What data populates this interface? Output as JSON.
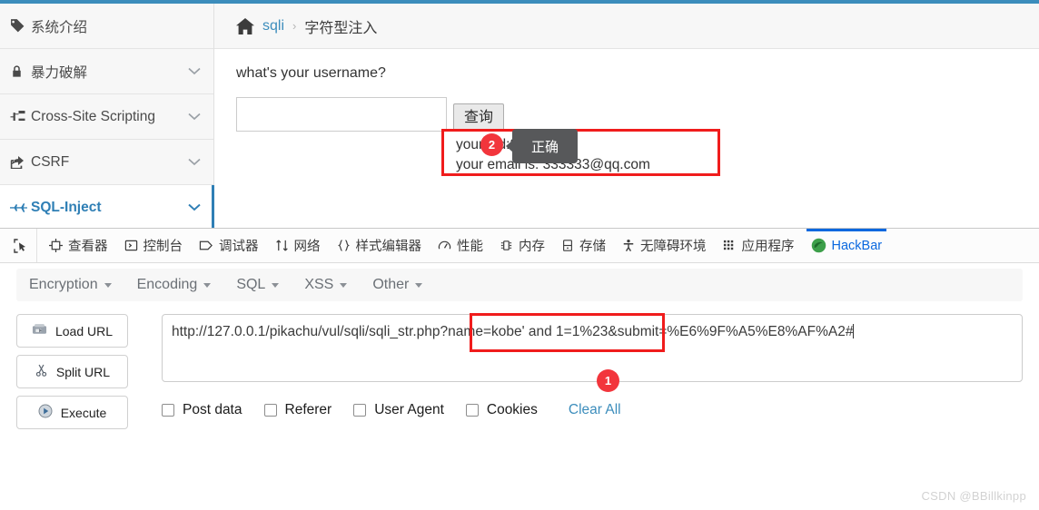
{
  "theme": {
    "accent_blue": "#3c8dbc",
    "tab_active_blue": "#0a68df",
    "highlight_red": "#f01c1c",
    "badge_red": "#f2353c",
    "tooltip_gray": "#57585a"
  },
  "sidebar": {
    "items": [
      {
        "label": "系统介绍",
        "icon": "tag-icon",
        "has_chevron": false,
        "active": false
      },
      {
        "label": "暴力破解",
        "icon": "lock-icon",
        "has_chevron": true,
        "active": false
      },
      {
        "label": "Cross-Site Scripting",
        "icon": "sitemap-icon",
        "has_chevron": true,
        "active": false
      },
      {
        "label": "CSRF",
        "icon": "share-icon",
        "has_chevron": true,
        "active": false
      },
      {
        "label": "SQL-Inject",
        "icon": "plane-icon",
        "has_chevron": true,
        "active": true
      }
    ]
  },
  "breadcrumb": {
    "home_icon": "home-icon",
    "root": "sqli",
    "separator": "›",
    "current": "字符型注入"
  },
  "form": {
    "question": "what's your username?",
    "input_value": "",
    "input_placeholder": "",
    "submit_label": "查询"
  },
  "result": {
    "line1": "your uid:3",
    "line2": "your email is: 333333@qq.com"
  },
  "annotations": {
    "badge_two": "2",
    "badge_one": "1",
    "tooltip": "正确"
  },
  "devtools": {
    "picker_icon": "cursor-picker-icon",
    "tabs": [
      {
        "label": "查看器",
        "icon": "inspector-icon",
        "selected": false
      },
      {
        "label": "控制台",
        "icon": "console-icon",
        "selected": false
      },
      {
        "label": "调试器",
        "icon": "debugger-icon",
        "selected": false
      },
      {
        "label": "网络",
        "icon": "network-icon",
        "selected": false
      },
      {
        "label": "样式编辑器",
        "icon": "style-editor-icon",
        "selected": false
      },
      {
        "label": "性能",
        "icon": "performance-icon",
        "selected": false
      },
      {
        "label": "内存",
        "icon": "memory-icon",
        "selected": false
      },
      {
        "label": "存储",
        "icon": "storage-icon",
        "selected": false
      },
      {
        "label": "无障碍环境",
        "icon": "accessibility-icon",
        "selected": false
      },
      {
        "label": "应用程序",
        "icon": "application-icon",
        "selected": false
      },
      {
        "label": "HackBar",
        "icon": "hackbar-icon",
        "selected": true
      }
    ]
  },
  "hackbar": {
    "menu": [
      {
        "label": "Encryption"
      },
      {
        "label": "Encoding"
      },
      {
        "label": "SQL"
      },
      {
        "label": "XSS"
      },
      {
        "label": "Other"
      }
    ],
    "actions": [
      {
        "label": "Load URL",
        "icon": "load-url-icon"
      },
      {
        "label": "Split URL",
        "icon": "scissors-icon"
      },
      {
        "label": "Execute",
        "icon": "play-icon"
      }
    ],
    "url_base": "http://127.0.0.1/pikachu/vul/sqli/sqli_str.php",
    "url_query": "?name=kobe' and 1=1%23",
    "url_tail": "&submit=%E6%9F%A5%E8%AF%A2#",
    "options": [
      {
        "label": "Post data",
        "checked": false
      },
      {
        "label": "Referer",
        "checked": false
      },
      {
        "label": "User Agent",
        "checked": false
      },
      {
        "label": "Cookies",
        "checked": false
      }
    ],
    "clear_all": "Clear All"
  },
  "watermark": "CSDN @BBillkinpp"
}
